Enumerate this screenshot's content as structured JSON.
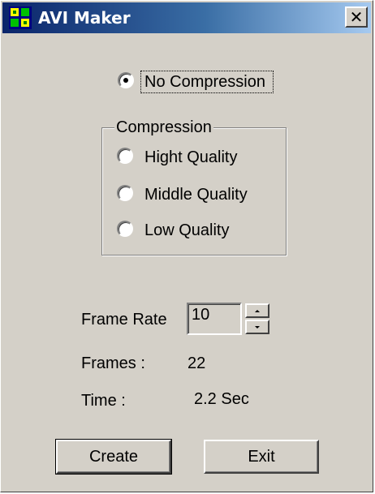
{
  "window": {
    "title": "AVI Maker",
    "close_glyph": "✕",
    "app_icon": "film-frames-icon"
  },
  "compression": {
    "no_compression_label": "No Compression",
    "group_label": "Compression",
    "options": [
      {
        "label": "Hight Quality",
        "checked": false
      },
      {
        "label": "Middle Quality",
        "checked": false
      },
      {
        "label": "Low Quality",
        "checked": false
      }
    ],
    "no_compression_checked": true
  },
  "stats": {
    "frame_rate_label": "Frame Rate",
    "frame_rate_value": "10",
    "frames_label": "Frames :",
    "frames_value": "22",
    "time_label": "Time :",
    "time_value": "2.2 Sec"
  },
  "buttons": {
    "create": "Create",
    "exit": "Exit"
  },
  "colors": {
    "face": "#d4d0c8",
    "title_start": "#0a246a",
    "title_end": "#a6caf0"
  }
}
